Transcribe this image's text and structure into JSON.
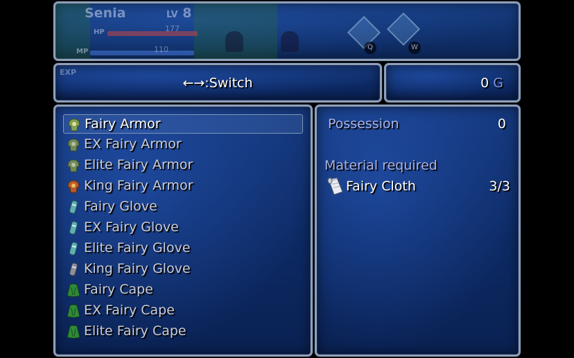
{
  "status": {
    "name": "Senia",
    "level_label": "LV",
    "level": "8",
    "hp_label": "HP",
    "mp_label": "MP",
    "hp_value": "177",
    "mp_value": "110",
    "key_q": "Q",
    "key_w": "W"
  },
  "help": {
    "exp_label": "EXP",
    "switch_text": "←→:Switch"
  },
  "gold": {
    "amount": "0",
    "unit": "G"
  },
  "items": [
    {
      "label": "Fairy Armor",
      "icon": "fairy-armor-icon",
      "selected": true
    },
    {
      "label": "EX Fairy Armor",
      "icon": "fairy-armor-icon"
    },
    {
      "label": "Elite Fairy Armor",
      "icon": "fairy-armor-icon"
    },
    {
      "label": "King Fairy Armor",
      "icon": "king-armor-icon"
    },
    {
      "label": "Fairy Glove",
      "icon": "glove-icon"
    },
    {
      "label": "EX Fairy Glove",
      "icon": "glove-icon"
    },
    {
      "label": "Elite Fairy Glove",
      "icon": "glove-icon"
    },
    {
      "label": "King Fairy Glove",
      "icon": "gray-glove-icon"
    },
    {
      "label": "Fairy Cape",
      "icon": "cape-icon"
    },
    {
      "label": "EX Fairy Cape",
      "icon": "cape-icon"
    },
    {
      "label": "Elite Fairy Cape",
      "icon": "cape-icon"
    }
  ],
  "detail": {
    "possession_label": "Possession",
    "possession_value": "0",
    "material_heading": "Material required",
    "material_name": "Fairy Cloth",
    "material_count": "3/3",
    "material_icon": "cloth-scroll-icon"
  },
  "colors": {
    "window_blue": "#0d2a64",
    "border": "#8fa0b8",
    "label_purple": "#a9b4e8",
    "gold_unit": "#7f97e6"
  }
}
